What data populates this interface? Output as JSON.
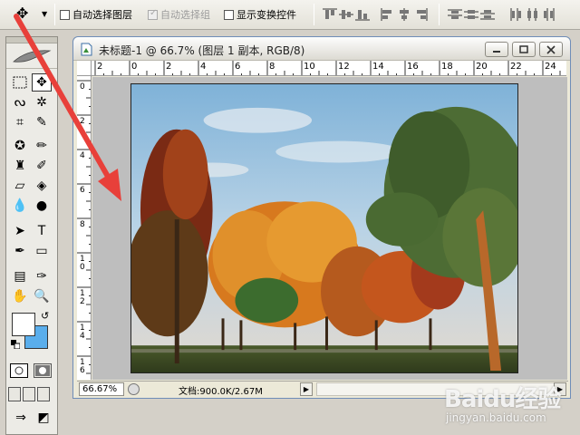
{
  "options_bar": {
    "auto_select_layer": "自动选择图层",
    "auto_select_group": "自动选择组",
    "show_transform_controls": "显示变换控件"
  },
  "document": {
    "title": "未标题-1 @ 66.7% (图层 1 副本, RGB/8)",
    "ruler_h": [
      "2",
      "0",
      "2",
      "4",
      "6",
      "8",
      "10",
      "12",
      "14",
      "16",
      "18",
      "20",
      "22",
      "24"
    ],
    "ruler_v": [
      "0",
      "2",
      "4",
      "6",
      "8",
      "1\n0",
      "1\n2",
      "1\n4",
      "1\n6"
    ],
    "zoom": "66.67%",
    "doc_info": "文档:900.0K/2.67M"
  },
  "colors": {
    "foreground": "#ffffff",
    "background": "#5aaeec",
    "annotation_arrow": "#e8403a"
  },
  "watermark": {
    "logo_text": "Baidu经验",
    "url": "jingyan.baidu.com"
  }
}
